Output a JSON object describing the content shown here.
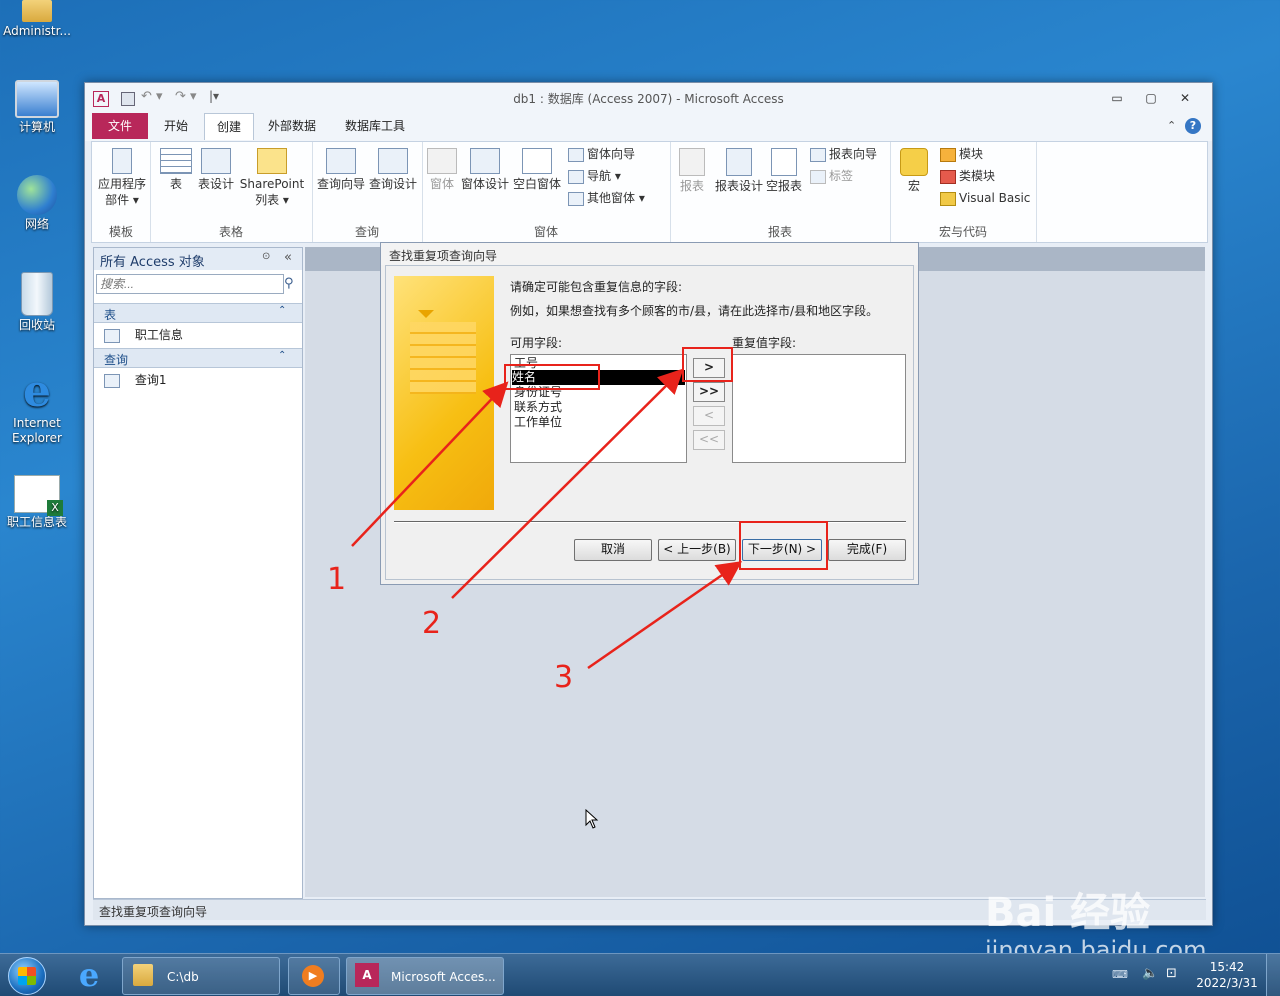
{
  "desktop": {
    "icons": [
      {
        "label": "Administr..."
      },
      {
        "label": "计算机"
      },
      {
        "label": "网络"
      },
      {
        "label": "回收站"
      },
      {
        "label": "Internet Explorer"
      },
      {
        "label": "职工信息表"
      }
    ]
  },
  "window": {
    "title": "db1 : 数据库 (Access 2007) - Microsoft Access",
    "controls": {
      "minimize": "▭",
      "maximize": "▢",
      "close": "✕"
    },
    "tabs": [
      "文件",
      "开始",
      "创建",
      "外部数据",
      "数据库工具"
    ]
  },
  "ribbon": {
    "groups": {
      "templates": {
        "label": "模板",
        "app_parts": "应用程序",
        "app_parts2": "部件 ▾"
      },
      "tables": {
        "label": "表格",
        "table": "表",
        "table_design": "表设计",
        "sharepoint": "SharePoint",
        "sharepoint2": "列表 ▾"
      },
      "queries": {
        "label": "查询",
        "wizard": "查询向导",
        "design": "查询设计"
      },
      "forms": {
        "label": "窗体",
        "form": "窗体",
        "form_design": "窗体设计",
        "blank_form": "空白窗体",
        "form_wizard": "窗体向导",
        "navigation": "导航 ▾",
        "more_forms": "其他窗体 ▾"
      },
      "reports": {
        "label": "报表",
        "report": "报表",
        "report_design": "报表设计",
        "blank_report": "空报表",
        "report_wizard": "报表向导",
        "labels": "标签"
      },
      "macros": {
        "label": "宏与代码",
        "macro": "宏",
        "module": "模块",
        "class_module": "类模块",
        "vb": "Visual Basic"
      }
    }
  },
  "nav": {
    "header": "所有 Access 对象",
    "search_placeholder": "搜索...",
    "sections": [
      {
        "title": "表",
        "items": [
          "职工信息"
        ]
      },
      {
        "title": "查询",
        "items": [
          "查询1"
        ]
      }
    ]
  },
  "status": {
    "text": "查找重复项查询向导"
  },
  "dialog": {
    "title": "查找重复项查询向导",
    "prompt": "请确定可能包含重复信息的字段:",
    "example": "例如，如果想查找有多个顾客的市/县，请在此选择市/县和地区字段。",
    "available_label": "可用字段:",
    "available_fields": [
      "工号",
      "姓名",
      "身份证号",
      "联系方式",
      "工作单位"
    ],
    "selected_index": 1,
    "duplicate_label": "重复值字段:",
    "move_buttons": [
      ">",
      ">>",
      "<",
      "<<"
    ],
    "buttons": {
      "cancel": "取消",
      "back": "< 上一步(B)",
      "next": "下一步(N) >",
      "finish": "完成(F)"
    }
  },
  "annotations": [
    "1",
    "2",
    "3"
  ],
  "taskbar": {
    "items": [
      {
        "label": "C:\\db"
      },
      {
        "label": ""
      },
      {
        "label": "Microsoft Acces..."
      }
    ],
    "time": "15:42",
    "date": "2022/3/31"
  },
  "watermark": {
    "brand": "Bai 经验",
    "url": "jingyan.baidu.com"
  },
  "colors": {
    "file_tab": "#b8275a",
    "highlight": "#e8231b",
    "selection": "#000000"
  }
}
